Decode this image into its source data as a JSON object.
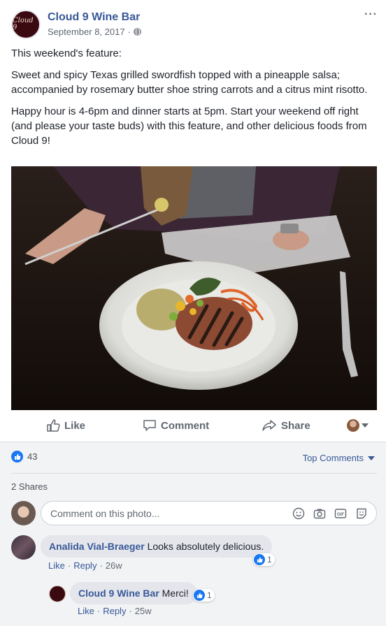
{
  "post": {
    "page_name": "Cloud 9 Wine Bar",
    "logo_text": "Cloud 9",
    "date": "September 8, 2017",
    "separator": "·",
    "more_icon": "more-options-icon",
    "paragraphs": [
      "This weekend's feature:",
      "Sweet and spicy Texas grilled swordfish topped with a pineapple salsa; accompanied by rosemary butter shoe string carrots and a citrus mint risotto.",
      "Happy hour is 4-6pm and dinner starts at 5pm. Start your weekend off right (and please your taste buds) with this feature, and other delicious foods from Cloud 9!"
    ]
  },
  "actions": {
    "like": "Like",
    "comment": "Comment",
    "share": "Share"
  },
  "feedback": {
    "like_count": "43",
    "sort_label": "Top Comments",
    "shares": "2 Shares",
    "composer_placeholder": "Comment on this photo..."
  },
  "comments": [
    {
      "author": "Analida Vial-Braeger",
      "text": "Looks absolutely delicious.",
      "like_link": "Like",
      "reply_link": "Reply",
      "time": "26w",
      "reaction_count": "1"
    },
    {
      "author": "Cloud 9 Wine Bar",
      "text": "Merci!",
      "like_link": "Like",
      "reply_link": "Reply",
      "time": "25w",
      "reaction_count": "1"
    }
  ],
  "colors": {
    "link_blue": "#385898",
    "like_blue": "#1877f2",
    "muted_text": "#606770",
    "feedback_bg": "#f2f3f5"
  }
}
